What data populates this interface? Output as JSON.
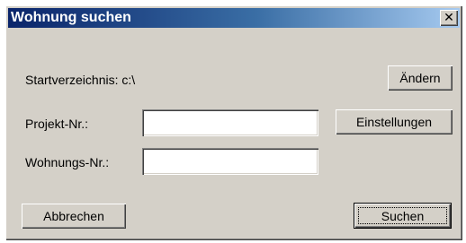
{
  "window": {
    "title": "Wohnung suchen",
    "close_glyph": "✕",
    "close_icon": "close-icon"
  },
  "form": {
    "start_dir_label": "Startverzeichnis: c:\\",
    "project_label": "Projekt-Nr.:",
    "project_value": "",
    "apartment_label": "Wohnungs-Nr.:",
    "apartment_value": ""
  },
  "buttons": {
    "change": "Ändern",
    "settings": "Einstellungen",
    "cancel": "Abbrechen",
    "search": "Suchen"
  },
  "colors": {
    "titlebar_start": "#0a246a",
    "titlebar_end": "#a6caf0",
    "face": "#d4d0c8"
  }
}
